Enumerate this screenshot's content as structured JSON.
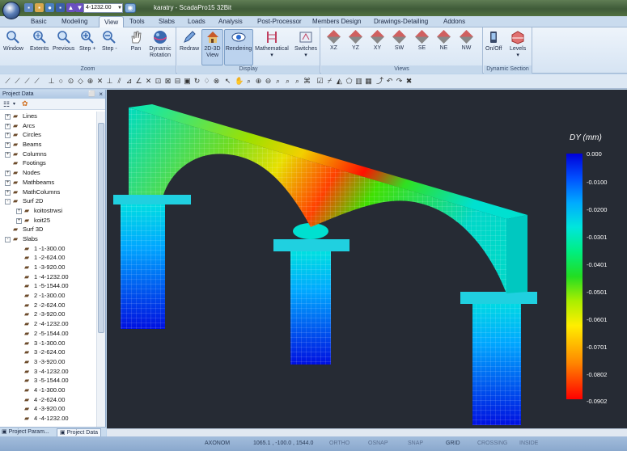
{
  "titlebar": {
    "view_name": "4-1232.00",
    "doc_title": "karatry - ScadaPro15 32Bit",
    "view_icon": "eye-icon"
  },
  "tabs": [
    "Basic",
    "Modeling",
    "View",
    "Tools",
    "Slabs",
    "Loads",
    "Analysis",
    "Post-Processor",
    "Members Design",
    "Drawings-Detailing",
    "Addons"
  ],
  "ribbon": {
    "zoom": {
      "label": "Zoom",
      "buttons": [
        "Window",
        "Extents",
        "Previous",
        "Step +",
        "Step -",
        "Pan",
        "Dynamic Rotation"
      ]
    },
    "display": {
      "label": "Display",
      "buttons": [
        "Redraw",
        "2D-3D View",
        "Rendering",
        "Mathematical",
        "Switches"
      ]
    },
    "views": {
      "label": "Views",
      "buttons": [
        "XZ",
        "YZ",
        "XY",
        "SW",
        "SE",
        "NE",
        "NW"
      ]
    },
    "section": {
      "label": "Dynamic Section",
      "buttons": [
        "On/Off",
        "Levels"
      ]
    }
  },
  "panel": {
    "title": "Project Data",
    "pin": "⬜",
    "close": "×",
    "tabs": [
      "Project Param...",
      "Project Data"
    ]
  },
  "tree": [
    {
      "label": "Lines",
      "level": 0,
      "exp": "+"
    },
    {
      "label": "Arcs",
      "level": 0,
      "exp": "+"
    },
    {
      "label": "Circles",
      "level": 0,
      "exp": "+"
    },
    {
      "label": "Beams",
      "level": 0,
      "exp": "+"
    },
    {
      "label": "Columns",
      "level": 0,
      "exp": "+"
    },
    {
      "label": "Footings",
      "level": 0,
      "exp": ""
    },
    {
      "label": "Nodes",
      "level": 0,
      "exp": "+"
    },
    {
      "label": "Mathbeams",
      "level": 0,
      "exp": "+"
    },
    {
      "label": "MathColumns",
      "level": 0,
      "exp": "+"
    },
    {
      "label": "Surf 2D",
      "level": 0,
      "exp": "-"
    },
    {
      "label": "koitostrwsi",
      "level": 1,
      "exp": "+"
    },
    {
      "label": "koit25",
      "level": 1,
      "exp": "+"
    },
    {
      "label": "Surf 3D",
      "level": 0,
      "exp": ""
    },
    {
      "label": "Slabs",
      "level": 0,
      "exp": "-"
    },
    {
      "label": "1 -1-300.00",
      "level": 1,
      "exp": ""
    },
    {
      "label": "1 -2-624.00",
      "level": 1,
      "exp": ""
    },
    {
      "label": "1 -3-920.00",
      "level": 1,
      "exp": ""
    },
    {
      "label": "1 -4-1232.00",
      "level": 1,
      "exp": ""
    },
    {
      "label": "1 -5-1544.00",
      "level": 1,
      "exp": ""
    },
    {
      "label": "2 -1-300.00",
      "level": 1,
      "exp": ""
    },
    {
      "label": "2 -2-624.00",
      "level": 1,
      "exp": ""
    },
    {
      "label": "2 -3-920.00",
      "level": 1,
      "exp": ""
    },
    {
      "label": "2 -4-1232.00",
      "level": 1,
      "exp": ""
    },
    {
      "label": "2 -5-1544.00",
      "level": 1,
      "exp": ""
    },
    {
      "label": "3 -1-300.00",
      "level": 1,
      "exp": ""
    },
    {
      "label": "3 -2-624.00",
      "level": 1,
      "exp": ""
    },
    {
      "label": "3 -3-920.00",
      "level": 1,
      "exp": ""
    },
    {
      "label": "3 -4-1232.00",
      "level": 1,
      "exp": ""
    },
    {
      "label": "3 -5-1544.00",
      "level": 1,
      "exp": ""
    },
    {
      "label": "4 -1-300.00",
      "level": 1,
      "exp": ""
    },
    {
      "label": "4 -2-624.00",
      "level": 1,
      "exp": ""
    },
    {
      "label": "4 -3-920.00",
      "level": 1,
      "exp": ""
    },
    {
      "label": "4 -4-1232.00",
      "level": 1,
      "exp": ""
    }
  ],
  "legend": {
    "title": "DY (mm)",
    "ticks": [
      "0.000",
      "-0.0100",
      "-0.0200",
      "-0.0301",
      "-0.0401",
      "-0.0501",
      "-0.0601",
      "-0.0701",
      "-0.0802",
      "-0.0902"
    ]
  },
  "status": {
    "mode": "AXONOM",
    "coords": "1065.1 , -100.0 , 1544.0",
    "ortho": "ORTHO",
    "osnap": "OSNAP",
    "snap": "SNAP",
    "grid": "GRID",
    "crossing": "CROSSING",
    "inside": "INSIDE"
  },
  "colors": {
    "accent": "#1e2b45",
    "ribbon_bg": "#d6e4f3",
    "viewport_bg": "#262b34"
  }
}
